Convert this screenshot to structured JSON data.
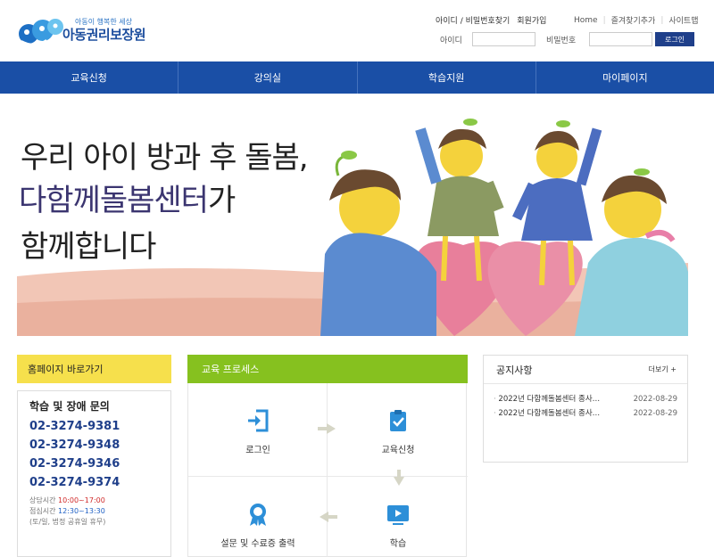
{
  "header": {
    "logo_tagline": "아동이 행복한 세상",
    "logo_name": "아동권리보장원",
    "find_account": "아이디 / 비밀번호찾기",
    "join": "회원가입",
    "home": "Home",
    "bookmark": "즐겨찾기추가",
    "sitemap": "사이트맵",
    "id_label": "아이디",
    "pw_label": "비밀번호",
    "login_button": "로그인"
  },
  "nav": {
    "items": [
      {
        "label": "교육신청"
      },
      {
        "label": "강의실"
      },
      {
        "label": "학습지원"
      },
      {
        "label": "마이페이지"
      }
    ]
  },
  "hero": {
    "line1": "우리 아이 방과 후 돌봄,",
    "line2_main": "다함께돌봄센터",
    "line2_suffix": "가",
    "line3": "함께합니다"
  },
  "quick": {
    "title": "홈페이지 바로가기",
    "box_title": "학습 및 장애 문의",
    "phones": [
      "02-3274-9381",
      "02-3274-9348",
      "02-3274-9346",
      "02-3274-9374"
    ],
    "consult_label": "상담시간",
    "consult_time": "10:00~17:00",
    "lunch_label": "점심시간",
    "lunch_time": "12:30~13:30",
    "closed_note": "(토/일, 법정 공휴일 휴무)"
  },
  "process": {
    "title": "교육 프로세스",
    "steps": [
      {
        "label": "로그인",
        "icon": "login-icon"
      },
      {
        "label": "교육신청",
        "icon": "clipboard-check-icon"
      },
      {
        "label": "학습",
        "icon": "video-play-icon"
      },
      {
        "label": "설문 및 수료증 출력",
        "icon": "certificate-ribbon-icon"
      }
    ]
  },
  "notice": {
    "title": "공지사항",
    "more": "더보기 +",
    "items": [
      {
        "title": "2022년 다함께돌봄센터 종사…",
        "date": "2022-08-29"
      },
      {
        "title": "2022년 다함께돌봄센터 종사…",
        "date": "2022-08-29"
      }
    ]
  },
  "colors": {
    "nav": "#1a4fa6",
    "quick_header": "#f6e04c",
    "process_header": "#86c11f",
    "primary_text": "#1f3f8a"
  }
}
